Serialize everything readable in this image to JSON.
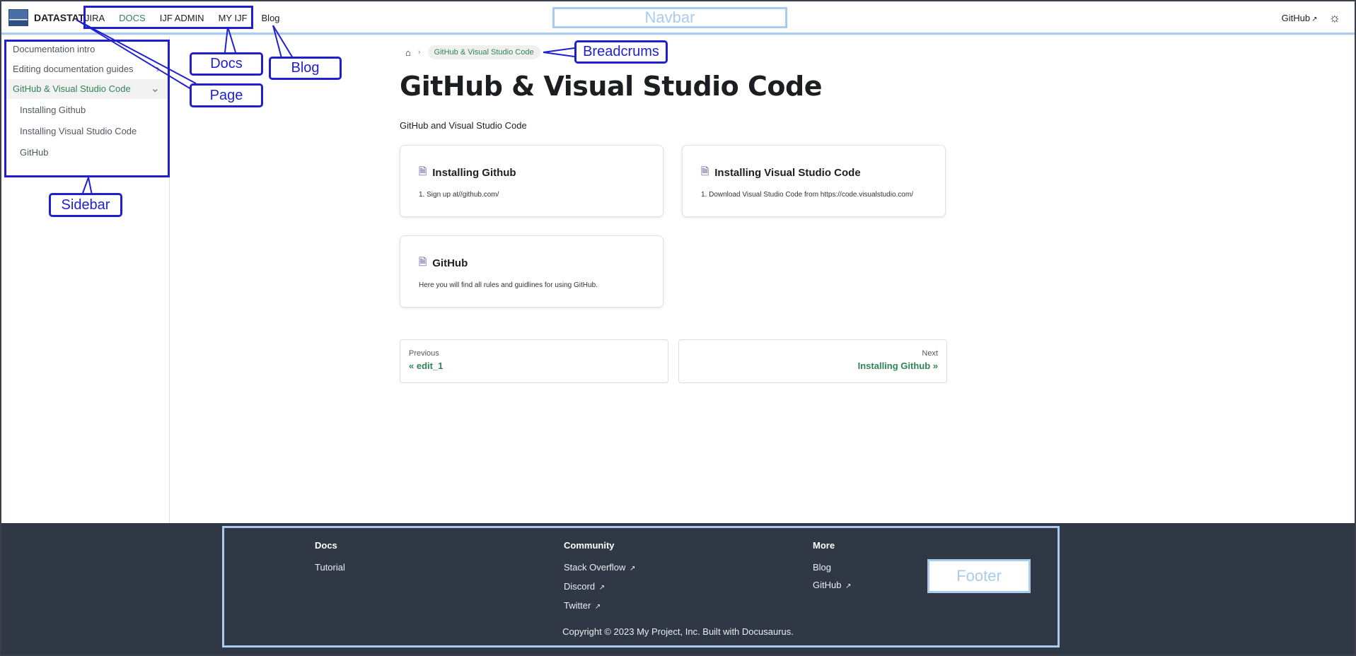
{
  "navbar": {
    "brand": "DATASTAT",
    "items": [
      "JIRA",
      "DOCS",
      "IJF ADMIN",
      "MY IJF",
      "Blog"
    ],
    "github": "GitHub",
    "theme_icon": "sun-icon"
  },
  "sidebar": {
    "items": [
      "Documentation intro",
      "Editing documentation guides",
      "GitHub & Visual Studio Code"
    ],
    "subitems": [
      "Installing Github",
      "Installing Visual Studio Code",
      "GitHub"
    ]
  },
  "breadcrumb": {
    "home_icon": "home-icon",
    "current": "GitHub & Visual Studio Code"
  },
  "main": {
    "title": "GitHub & Visual Studio Code",
    "description": "GitHub and Visual Studio Code",
    "cards": [
      {
        "title": "Installing Github",
        "desc": "1. Sign up at//github.com/"
      },
      {
        "title": "Installing Visual Studio Code",
        "desc": "1. Download Visual Studio Code from https://code.visualstudio.com/"
      },
      {
        "title": "GitHub",
        "desc": "Here you will find all rules and guidlines for using GitHub."
      }
    ],
    "pager": {
      "prev_sub": "Previous",
      "prev_label": "« edit_1",
      "next_sub": "Next",
      "next_label": "Installing Github »"
    }
  },
  "footer": {
    "columns": [
      {
        "title": "Docs",
        "links": [
          "Tutorial"
        ]
      },
      {
        "title": "Community",
        "links": [
          "Stack Overflow",
          "Discord",
          "Twitter"
        ]
      },
      {
        "title": "More",
        "links": [
          "Blog",
          "GitHub"
        ]
      }
    ],
    "copyright": "Copyright © 2023 My Project, Inc. Built with Docusaurus."
  },
  "annotations": {
    "navbar": "Navbar",
    "docs": "Docs",
    "blog": "Blog",
    "page": "Page",
    "breadcrums": "Breadcrums",
    "sidebar": "Sidebar",
    "footer": "Footer"
  },
  "colors": {
    "accent": "#2e8555",
    "annotation": "#1f1fd0",
    "annotation_light": "#a8cbef",
    "footer_bg": "#303846"
  }
}
